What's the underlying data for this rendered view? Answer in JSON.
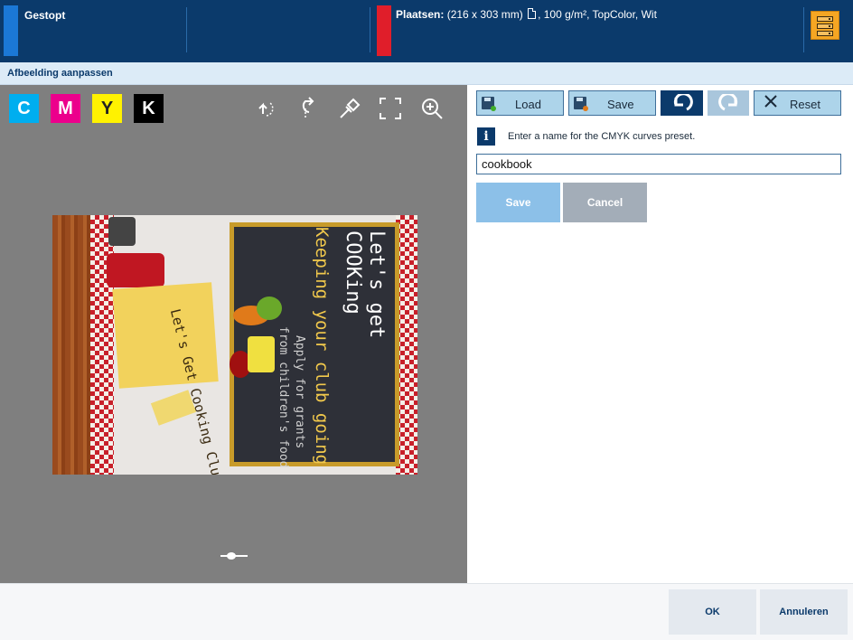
{
  "header": {
    "status": "Gestopt",
    "media_label": "Plaatsen:",
    "media_size": "(216 x 303 mm)",
    "media_details": ", 100 g/m², TopColor, Wit",
    "server_icon": "server-icon"
  },
  "dialog": {
    "title": "Afbeelding aanpassen"
  },
  "channels": [
    "C",
    "M",
    "Y",
    "K"
  ],
  "preview_tools": [
    "rotate-left-icon",
    "rotate-right-icon",
    "eyedropper-icon",
    "fit-to-screen-icon",
    "zoom-in-icon"
  ],
  "preview_image": {
    "cover_text": {
      "paper": "Let's Get Cooking Club",
      "board_title1": "Let's get",
      "board_title2": "COOKing",
      "board_line1": "Keeping your club going",
      "board_line2": "Apply for grants",
      "board_line3": "from children's food"
    }
  },
  "toolbar": {
    "load_label": "Load",
    "save_label": "Save",
    "reset_label": "Reset"
  },
  "preset_form": {
    "info": "Enter a name for the CMYK curves preset.",
    "name_value": "cookbook",
    "save_label": "Save",
    "cancel_label": "Cancel"
  },
  "footer": {
    "ok_label": "OK",
    "cancel_label": "Annuleren"
  },
  "colors": {
    "header_bg": "#0b3a6b",
    "accent_blue": "#1b78d6",
    "accent_red": "#e01e2a",
    "button_bg": "#add4ea",
    "preview_bg": "#7f7f7f"
  }
}
